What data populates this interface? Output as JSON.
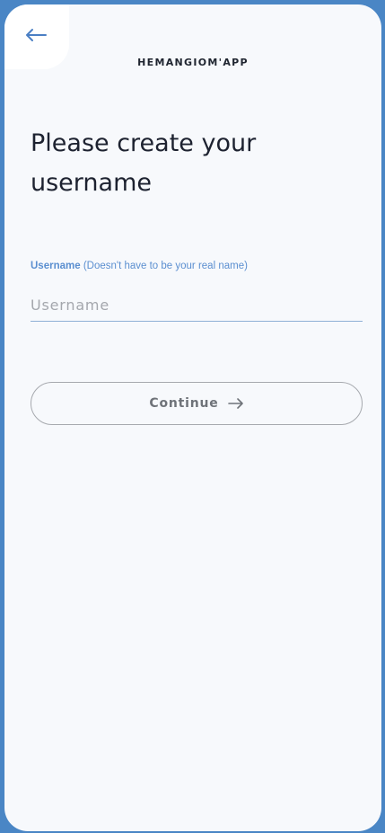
{
  "header": {
    "app_name": "HEMANGIOM'APP",
    "back_icon": "arrow-left-icon"
  },
  "page": {
    "title": "Please create your username"
  },
  "form": {
    "label_strong": "Username",
    "label_hint": " (Doesn't have to be your real name)",
    "username_value": "",
    "username_placeholder": "Username"
  },
  "actions": {
    "continue_label": "Continue",
    "continue_icon": "arrow-right-icon"
  },
  "colors": {
    "background": "#4a86c5",
    "accent": "#5b8fd0",
    "surface": "#f7f9fc"
  }
}
